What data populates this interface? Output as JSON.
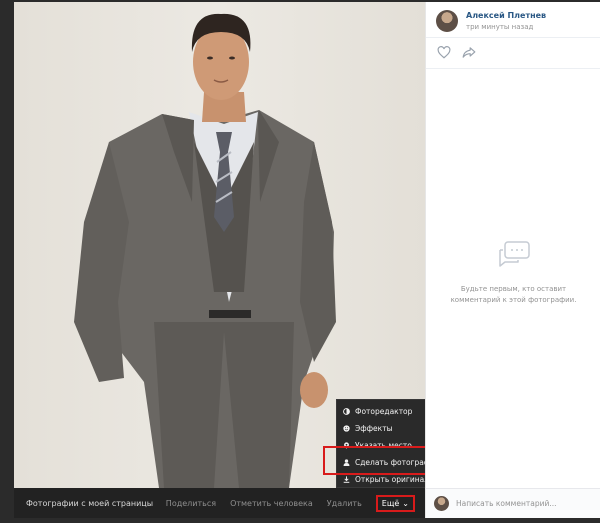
{
  "author": {
    "name": "Алексей Плетнев",
    "time": "три минуты назад"
  },
  "empty_comments": {
    "text": "Будьте первым, кто оставит комментарий к этой фотографии."
  },
  "comment": {
    "placeholder": "Написать комментарий..."
  },
  "photo_bar": {
    "album": "Фотографии с моей страницы",
    "share": "Поделиться",
    "tag": "Отметить человека",
    "delete": "Удалить",
    "more": "Ещё"
  },
  "menu": {
    "items": [
      {
        "label": "Фоторедактор",
        "icon": "half-circle-icon"
      },
      {
        "label": "Эффекты",
        "icon": "smile-icon"
      },
      {
        "label": "Указать место",
        "icon": "location-pin-icon"
      },
      {
        "label": "Сделать фотографией профиля",
        "icon": "person-icon"
      },
      {
        "label": "Открыть оригинал",
        "icon": "download-icon"
      }
    ]
  },
  "colors": {
    "highlight": "#d81b1b",
    "link": "#2a5885",
    "dark_bar": "#222222"
  }
}
